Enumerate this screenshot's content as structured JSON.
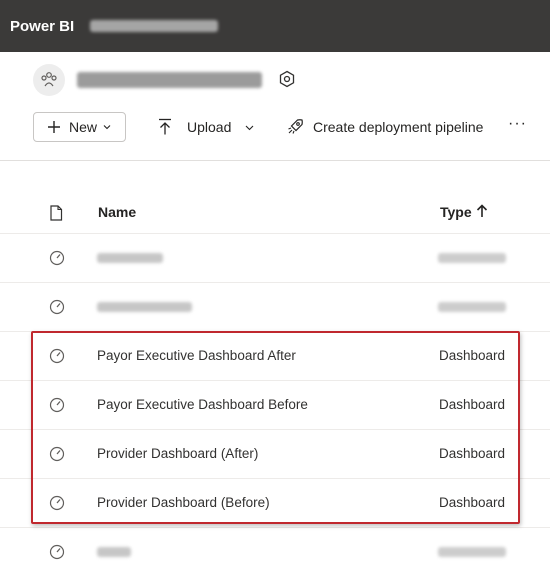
{
  "app": {
    "title": "Power BI"
  },
  "workspace": {
    "breadcrumb_obscured": true,
    "name_obscured": true
  },
  "toolbar": {
    "new_label": "New",
    "upload_label": "Upload",
    "deploy_label": "Create deployment pipeline",
    "more_label": "···"
  },
  "table": {
    "headers": {
      "name": "Name",
      "type": "Type"
    },
    "rows": [
      {
        "name": "",
        "type": "",
        "obscured": true
      },
      {
        "name": "",
        "type": "",
        "obscured": true
      },
      {
        "name": "Payor Executive Dashboard After",
        "type": "Dashboard"
      },
      {
        "name": "Payor Executive Dashboard Before",
        "type": "Dashboard"
      },
      {
        "name": "Provider Dashboard (After)",
        "type": "Dashboard"
      },
      {
        "name": "Provider Dashboard (Before)",
        "type": "Dashboard"
      },
      {
        "name": "",
        "type": "",
        "obscured": true
      }
    ]
  },
  "colors": {
    "topbar_bg": "#3b3a39",
    "highlight_border": "#c0282e",
    "text": "#252423"
  }
}
